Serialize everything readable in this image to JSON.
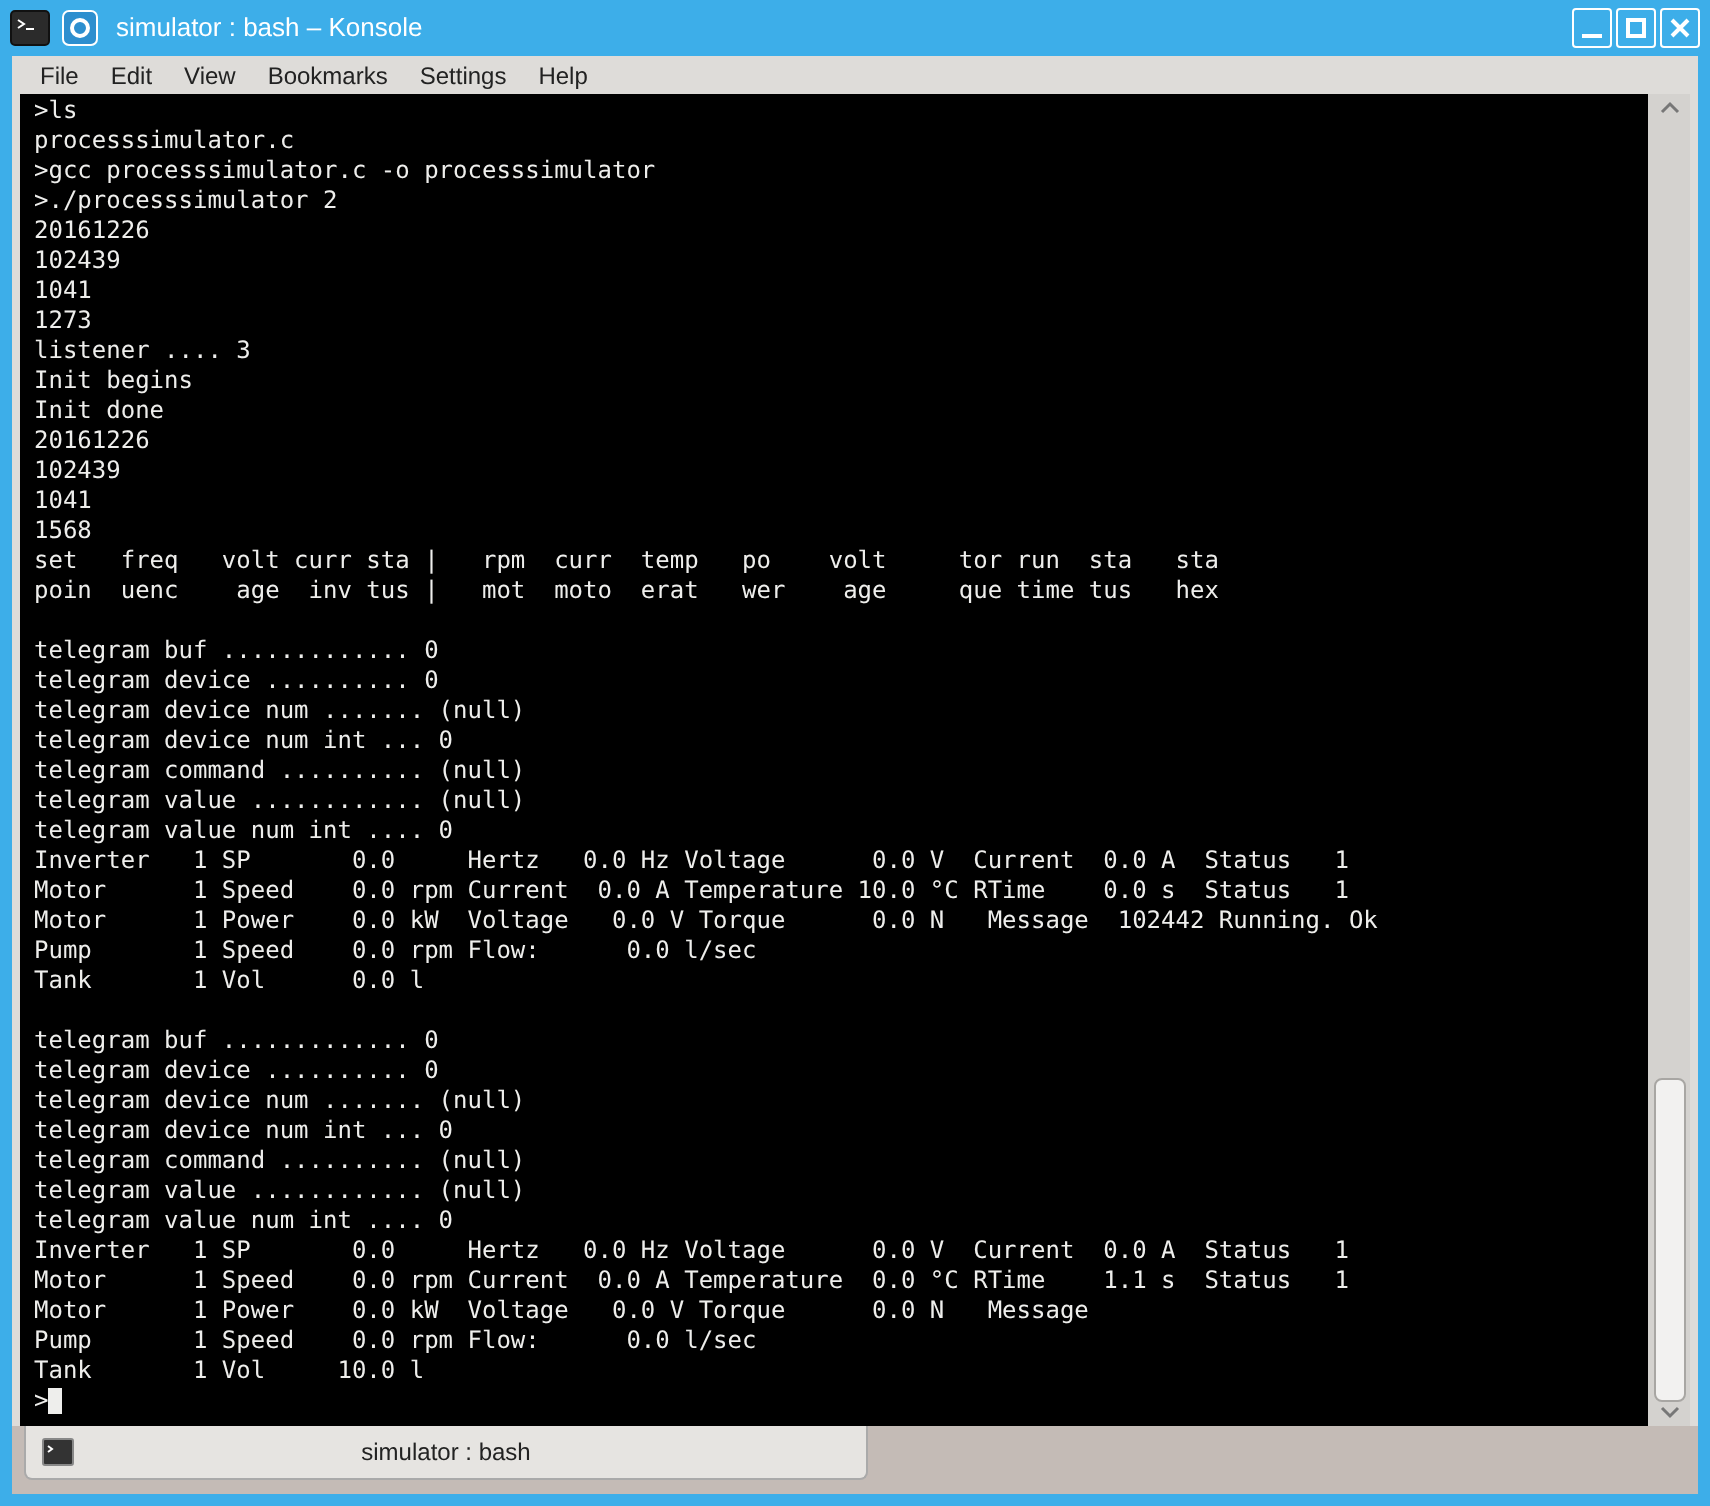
{
  "window": {
    "title": "simulator : bash – Konsole"
  },
  "menu": [
    "File",
    "Edit",
    "View",
    "Bookmarks",
    "Settings",
    "Help"
  ],
  "terminal": {
    "blocks": [
      [
        ">ls",
        "processsimulator.c",
        ">gcc processsimulator.c -o processsimulator",
        ">./processsimulator 2",
        "20161226",
        "102439",
        "1041",
        "1273",
        "listener .... 3",
        "Init begins",
        "Init done",
        "20161226",
        "102439",
        "1041",
        "1568",
        "set   freq   volt curr sta |   rpm  curr  temp   po    volt     tor run  sta   sta",
        "poin  uenc    age  inv tus |   mot  moto  erat   wer    age     que time tus   hex"
      ],
      [
        "telegram buf ............. 0",
        "telegram device .......... 0",
        "telegram device num ....... (null)",
        "telegram device num int ... 0",
        "telegram command .......... (null)",
        "telegram value ............ (null)",
        "telegram value num int .... 0",
        "Inverter   1 SP       0.0     Hertz   0.0 Hz Voltage      0.0 V  Current  0.0 A  Status   1",
        "Motor      1 Speed    0.0 rpm Current  0.0 A Temperature 10.0 °C RTime    0.0 s  Status   1",
        "Motor      1 Power    0.0 kW  Voltage   0.0 V Torque      0.0 N   Message  102442 Running. Ok",
        "Pump       1 Speed    0.0 rpm Flow:      0.0 l/sec",
        "Tank       1 Vol      0.0 l"
      ],
      [
        "telegram buf ............. 0",
        "telegram device .......... 0",
        "telegram device num ....... (null)",
        "telegram device num int ... 0",
        "telegram command .......... (null)",
        "telegram value ............ (null)",
        "telegram value num int .... 0",
        "Inverter   1 SP       0.0     Hertz   0.0 Hz Voltage      0.0 V  Current  0.0 A  Status   1",
        "Motor      1 Speed    0.0 rpm Current  0.0 A Temperature  0.0 °C RTime    1.1 s  Status   1",
        "Motor      1 Power    0.0 kW  Voltage   0.0 V Torque      0.0 N   Message",
        "Pump       1 Speed    0.0 rpm Flow:      0.0 l/sec",
        "Tank       1 Vol     10.0 l"
      ]
    ],
    "prompt": ">",
    "cursor": true
  },
  "tabs": [
    {
      "label": "simulator : bash",
      "selected": true
    }
  ]
}
